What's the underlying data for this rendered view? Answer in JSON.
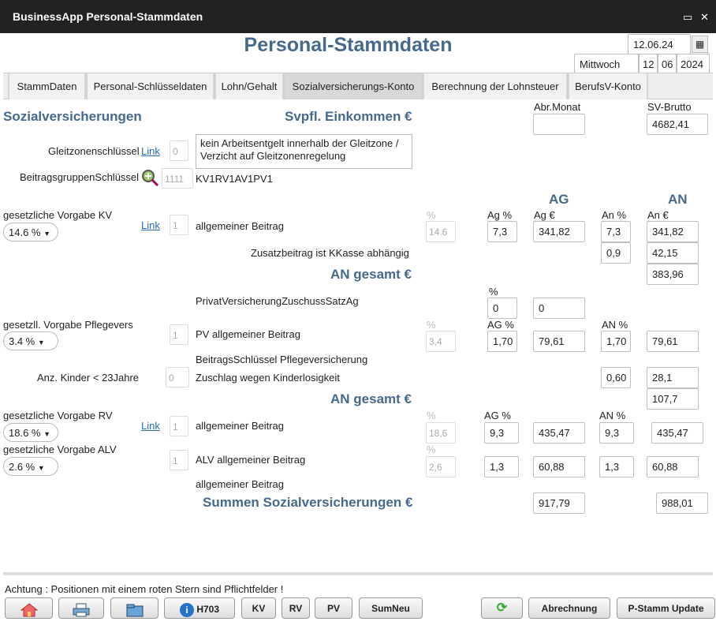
{
  "window": {
    "title": "BusinessApp Personal-Stammdaten",
    "restore_glyph": "▭",
    "close_glyph": "✕"
  },
  "page_title": "Personal-Stammdaten",
  "date": {
    "full": "12.06.24",
    "weekday": "Mittwoch",
    "day": "12",
    "month": "06",
    "year": "2024"
  },
  "tabs": [
    "StammDaten",
    "Personal-Schlüsseldaten",
    "Lohn/Gehalt",
    "Sozialversicherungs-Konto",
    "Berechnung der Lohnsteuer",
    "BerufsV-Konto"
  ],
  "sections": {
    "sv": "Sozialversicherungen",
    "einkommen": "Svpfl. Einkommen €",
    "an_gesamt1": "AN gesamt €",
    "an_gesamt2": "AN gesamt €",
    "summen": "Summen Sozialversicherungen €"
  },
  "top": {
    "abr_monat_label": "Abr.Monat",
    "abr_monat_value": "",
    "sv_brutto_label": "SV-Brutto",
    "sv_brutto_value": "4682,41"
  },
  "gleitzone": {
    "label": "Gleitzonenschlüssel",
    "link": "Link",
    "value": "0",
    "text": "kein Arbeitsentgelt innerhalb der Gleitzone / Verzicht auf Gleitzonenregelung"
  },
  "beitragsgruppe": {
    "label": "BeitragsgruppenSchlüssel",
    "value": "1111",
    "code": "KV1RV1AV1PV1"
  },
  "col": {
    "ag": "AG",
    "an": "AN",
    "pct": "%",
    "ag_pct": "Ag %",
    "ag_eur": "Ag €",
    "an_pct": "An %",
    "an_eur": "An €",
    "ag_pct2": "AG %",
    "an_pct2": "AN %"
  },
  "kv": {
    "label": "gesetzliche Vorgabe KV",
    "select": "14.6 %",
    "link": "Link",
    "num": "1",
    "desc": "allgemeiner Beitrag",
    "pct": "14.6",
    "ag_pct": "7,3",
    "ag_eur": "341,82",
    "an_pct": "7,3",
    "an_eur": "341,82",
    "zusatz_label": "Zusatzbeitrag ist KKasse abhängig",
    "zusatz_pct": "0,9",
    "zusatz_eur": "42,15",
    "an_gesamt": "383,96"
  },
  "privat": {
    "label": "PrivatVersicherungZuschussSatzAg",
    "pct": "0",
    "eur": "0"
  },
  "pv": {
    "label": "gesetzll. Vorgabe Pflegevers",
    "select": "3.4 %",
    "num": "1",
    "desc": "PV allgemeiner Beitrag",
    "pct": "3,4",
    "ag_pct": "1,70",
    "ag_eur": "79,61",
    "an_pct": "1,70",
    "an_eur": "79,61",
    "bs_label": "BeitragsSchlüssel Pflegeversicherung",
    "kinder_label": "Anz. Kinder < 23Jahre",
    "kinder_value": "0",
    "zuschlag_label": "Zuschlag wegen Kinderlosigkeit",
    "zuschlag_pct": "0,60",
    "zuschlag_eur": "28,1",
    "an_gesamt": "107,7"
  },
  "rv": {
    "label": "gesetzliche Vorgabe RV",
    "select": "18.6 %",
    "link": "Link",
    "num": "1",
    "desc": "allgemeiner Beitrag",
    "pct": "18,6",
    "ag_pct": "9,3",
    "ag_eur": "435,47",
    "an_pct": "9,3",
    "an_eur": "435,47"
  },
  "alv": {
    "label": "gesetzliche Vorgabe ALV",
    "select": "2.6 %",
    "num": "1",
    "desc": "ALV allgemeiner Beitrag",
    "pct": "2,6",
    "ag_pct": "1,3",
    "ag_eur": "60,88",
    "an_pct": "1,3",
    "an_eur": "60,88",
    "desc2": "allgemeiner Beitrag"
  },
  "summen": {
    "ag": "917,79",
    "an": "988,01"
  },
  "notice": "Achtung : Positionen mit einem roten Stern sind Pflichtfelder !",
  "buttons": {
    "h703": "H703",
    "kv": "KV",
    "rv": "RV",
    "pv": "PV",
    "sumneu": "SumNeu",
    "abrechnung": "Abrechnung",
    "pstamm": "P-Stamm Update"
  }
}
